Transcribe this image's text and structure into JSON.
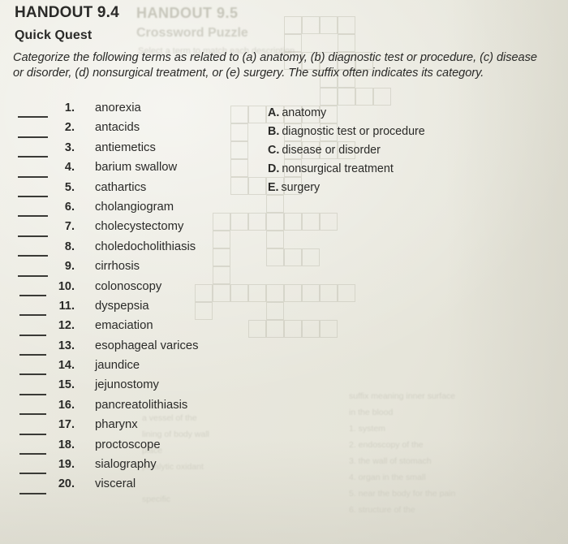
{
  "header": {
    "handout_label": "HANDOUT 9.4",
    "worksheet_title": "Quick Quest"
  },
  "instructions": {
    "text": "Categorize the following terms as related to (a) anatomy, (b) diagnostic test or procedure, (c) disease or disorder, (d) nonsurgical treatment, or (e) surgery. The suffix often indicates its category."
  },
  "terms": [
    {
      "number": "1.",
      "term": "anorexia"
    },
    {
      "number": "2.",
      "term": "antacids"
    },
    {
      "number": "3.",
      "term": "antiemetics"
    },
    {
      "number": "4.",
      "term": "barium swallow"
    },
    {
      "number": "5.",
      "term": "cathartics"
    },
    {
      "number": "6.",
      "term": "cholangiogram"
    },
    {
      "number": "7.",
      "term": "cholecystectomy"
    },
    {
      "number": "8.",
      "term": "choledocholithiasis"
    },
    {
      "number": "9.",
      "term": "cirrhosis"
    },
    {
      "number": "10.",
      "term": "colonoscopy"
    },
    {
      "number": "11.",
      "term": "dyspepsia"
    },
    {
      "number": "12.",
      "term": "emaciation"
    },
    {
      "number": "13.",
      "term": "esophageal varices"
    },
    {
      "number": "14.",
      "term": "jaundice"
    },
    {
      "number": "15.",
      "term": "jejunostomy"
    },
    {
      "number": "16.",
      "term": "pancreatolithiasis"
    },
    {
      "number": "17.",
      "term": "pharynx"
    },
    {
      "number": "18.",
      "term": "proctoscope"
    },
    {
      "number": "19.",
      "term": "sialography"
    },
    {
      "number": "20.",
      "term": "visceral"
    }
  ],
  "options": [
    {
      "letter": "A.",
      "label": "anatomy"
    },
    {
      "letter": "B.",
      "label": "diagnostic test or procedure"
    },
    {
      "letter": "C.",
      "label": "disease or disorder"
    },
    {
      "letter": "D.",
      "label": "nonsurgical treatment"
    },
    {
      "letter": "E.",
      "label": "surgery"
    }
  ],
  "showthrough": {
    "title": "HANDOUT 9.5",
    "subtitle": "Crossword Puzzle",
    "line": "Select a term to match each description",
    "left_block": "a vessel of the\nlining of body wall\nplace\nparalytic oxidant\n\nspecific",
    "right_block": "suffix meaning inner surface\nin the blood\n1. system\n2. endoscopy of the\n3. the wall of stomach\n4. organ in the small\n5. near the body for the pain\n6. structure of the",
    "colors": {
      "ink": "#b9b8ab"
    }
  },
  "colors": {
    "paper": "#e9e8de",
    "ink": "#2a2a28",
    "rule": "#3a3a36"
  }
}
